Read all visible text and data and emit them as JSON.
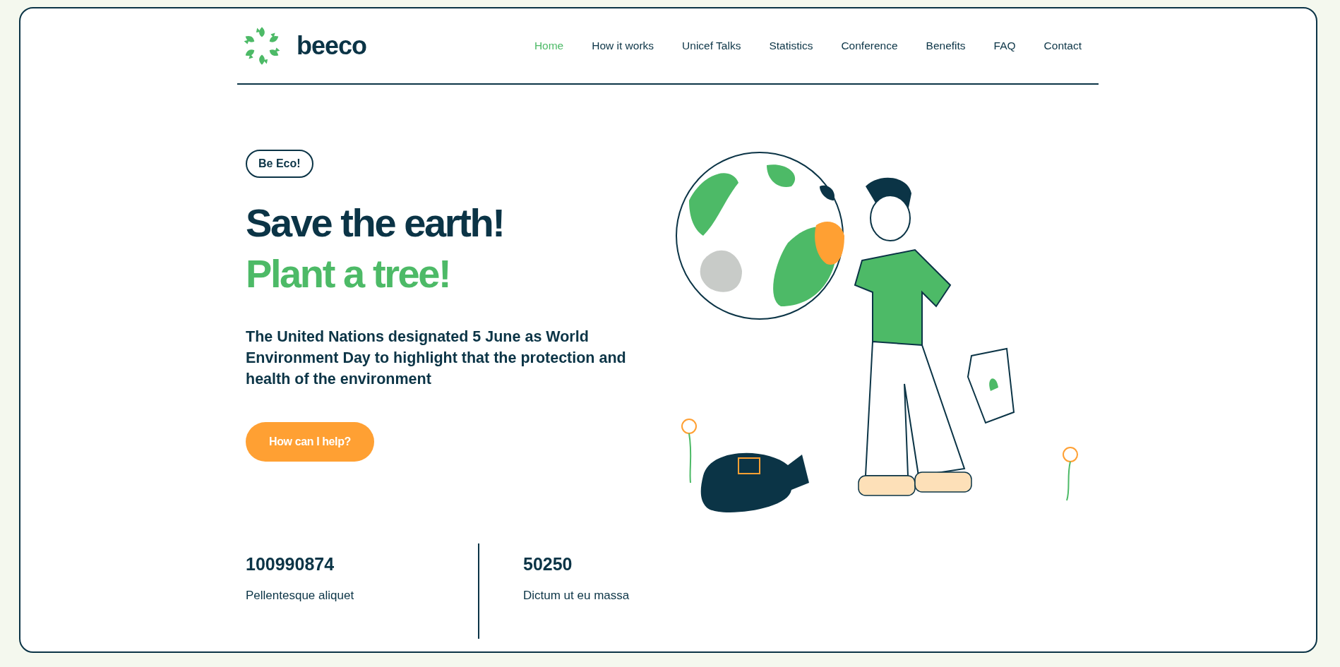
{
  "logo": {
    "text": "beeco"
  },
  "nav": [
    {
      "label": "Home",
      "selected": true
    },
    {
      "label": "How it works",
      "selected": false
    },
    {
      "label": "Unicef Talks",
      "selected": false
    },
    {
      "label": "Statistics",
      "selected": false
    },
    {
      "label": "Conference",
      "selected": false
    },
    {
      "label": "Benefits",
      "selected": false
    },
    {
      "label": "FAQ",
      "selected": false
    },
    {
      "label": "Contact",
      "selected": false
    }
  ],
  "hero": {
    "badge": "Be Eco!",
    "headline": "Save the earth!",
    "headline_accent": "Plant a tree!",
    "description": "The United Nations designated 5 June as World Environment Day to highlight that the protection and health of the environment",
    "button": "How can I help?"
  },
  "stats": [
    {
      "value": "100990874",
      "label": "Pellentesque aliquet"
    },
    {
      "value": "50250",
      "label": "Dictum ut eu massa"
    }
  ]
}
